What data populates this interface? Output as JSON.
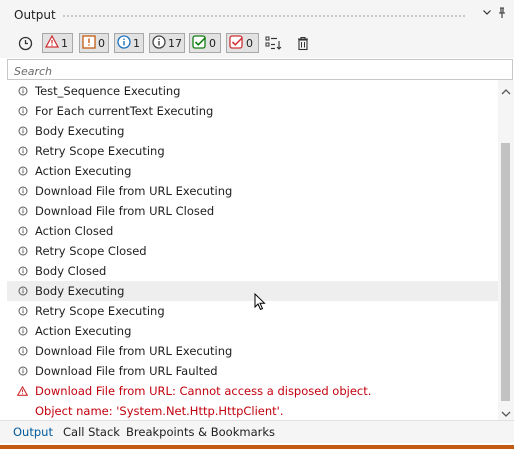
{
  "panel": {
    "title": "Output",
    "dropdown_icon": "chevron-down-icon",
    "pin_icon": "pin-icon"
  },
  "toolbar": {
    "history_icon": "clock-icon",
    "filters": [
      {
        "name": "errors",
        "icon": "error-triangle-icon",
        "count": "1",
        "color": "#d13438"
      },
      {
        "name": "warnings",
        "icon": "warning-icon",
        "count": "0",
        "color": "#c55a11"
      },
      {
        "name": "info",
        "icon": "info-icon",
        "count": "1",
        "color": "#1e73be"
      },
      {
        "name": "trace",
        "icon": "trace-icon",
        "count": "17",
        "color": "#444444"
      },
      {
        "name": "success",
        "icon": "check-icon",
        "count": "0",
        "color": "#107c10"
      },
      {
        "name": "failed",
        "icon": "failed-check-icon",
        "count": "0",
        "color": "#d13438"
      }
    ],
    "filter_icon": "filter-list-icon",
    "clear_icon": "trash-icon"
  },
  "search": {
    "placeholder": "Search",
    "value": ""
  },
  "log": [
    {
      "text": "Test_Sequence Executing",
      "level": "trace"
    },
    {
      "text": "For Each currentText Executing",
      "level": "trace"
    },
    {
      "text": "Body Executing",
      "level": "trace"
    },
    {
      "text": "Retry Scope Executing",
      "level": "trace"
    },
    {
      "text": "Action Executing",
      "level": "trace"
    },
    {
      "text": "Download File from URL Executing",
      "level": "trace"
    },
    {
      "text": "Download File from URL Closed",
      "level": "trace"
    },
    {
      "text": "Action Closed",
      "level": "trace"
    },
    {
      "text": "Retry Scope Closed",
      "level": "trace"
    },
    {
      "text": "Body Closed",
      "level": "trace"
    },
    {
      "text": "Body Executing",
      "level": "trace",
      "hover": true
    },
    {
      "text": "Retry Scope Executing",
      "level": "trace"
    },
    {
      "text": "Action Executing",
      "level": "trace"
    },
    {
      "text": "Download File from URL Executing",
      "level": "trace"
    },
    {
      "text": "Download File from URL Faulted",
      "level": "trace"
    },
    {
      "text": "Download File from URL: Cannot access a disposed object.",
      "level": "error"
    },
    {
      "text": "Object name: 'System.Net.Http.HttpClient'.",
      "level": "error-continued"
    }
  ],
  "tabs": [
    {
      "label": "Output",
      "active": true
    },
    {
      "label": "Call Stack",
      "active": false
    },
    {
      "label": "Breakpoints & Bookmarks",
      "active": false
    }
  ],
  "colors": {
    "error_text": "#c3000d",
    "accent": "#005a9e",
    "status_bar": "#c55a11"
  }
}
